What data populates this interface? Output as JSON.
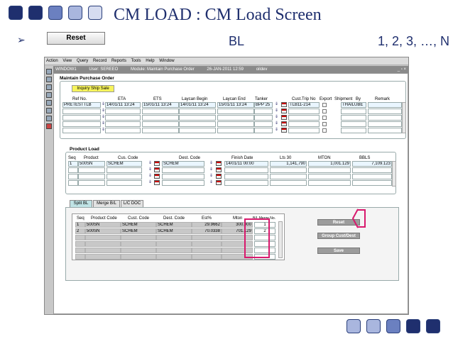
{
  "slide": {
    "title": "CM LOAD : CM Load Screen",
    "bullet": "➢",
    "reset_button": "Reset",
    "bl_label": "BL",
    "sequence_label": "1, 2, 3, …, N"
  },
  "colors": {
    "slide_blue": "#1f2f6e",
    "highlight": "#d8196d",
    "yellow_button": "#f6f35b",
    "active_tab": "#bfe3e5"
  },
  "menu": [
    "Action",
    "View",
    "Query",
    "Record",
    "Reports",
    "Tools",
    "Help",
    "Window"
  ],
  "window": {
    "name": "WINDOW1",
    "user": "User:  SEREEO",
    "module": "Module: Maintain Purchase Order",
    "datetime": "26-JAN-2011 12:59",
    "db": "oildev",
    "controls": "_ ▫ ×"
  },
  "toolbar_icons": [
    "save-icon",
    "print-icon",
    "query-icon",
    "next-icon",
    "prev-icon",
    "insert-icon",
    "delete-icon",
    "exit-icon"
  ],
  "purchase_order": {
    "section_title": "Maintain Purchase Order",
    "inquiry_button": "Inquiry Ship Sale",
    "columns": [
      "Ref No.",
      "ETA",
      "ETS",
      "Laycan Begin",
      "Laycan End",
      "Tanker",
      "Cust.Trip No",
      "Export",
      "Shipment",
      "By",
      "Remark"
    ],
    "row1": {
      "ref_no": "PRETESTTLB",
      "eta": "14/01/11 13:24",
      "ets": "15/01/11 13:24",
      "laycan_begin": "14/01/11 13:24",
      "laycan_end": "15/01/11 13:24",
      "tanker": "BPP 25",
      "cust_trip_no": "TLB11-214",
      "by": "THAILUBE"
    }
  },
  "product_load": {
    "section_title": "Product Load",
    "columns": [
      "Seq",
      "Product",
      "Cus. Code",
      "Dest. Code",
      "Finish Date",
      "Lts 30",
      "MTON",
      "BBLS"
    ],
    "row1": {
      "seq": "1",
      "product": "500SN",
      "cus_code": "SCHEM",
      "dest_code": "SCHEM",
      "finish_date": "14/01/11 00:00",
      "lts30": "1,141,790",
      "mton": "1,001.129",
      "bbls": "7,109.123"
    }
  },
  "tabs": [
    "Split BL",
    "Merge B/L",
    "L/C DOC"
  ],
  "split_bl": {
    "columns": [
      "Seq",
      "Product Code",
      "Cust. Code",
      "Dest. Code",
      "Est%",
      "Mton",
      "B/L Merge No."
    ],
    "rows": [
      {
        "seq": "1",
        "product": "500SN",
        "cust": "SCHEM",
        "dest": "SCHEM",
        "est": "29.9662",
        "mton": "300.000",
        "merge": "1"
      },
      {
        "seq": "2",
        "product": "500SN",
        "cust": "SCHEM",
        "dest": "SCHEM",
        "est": "70.0338",
        "mton": "701.129",
        "merge": "2"
      }
    ],
    "buttons": {
      "reset": "Reset",
      "group": "Group Cust/Dest",
      "save": "Save"
    }
  }
}
